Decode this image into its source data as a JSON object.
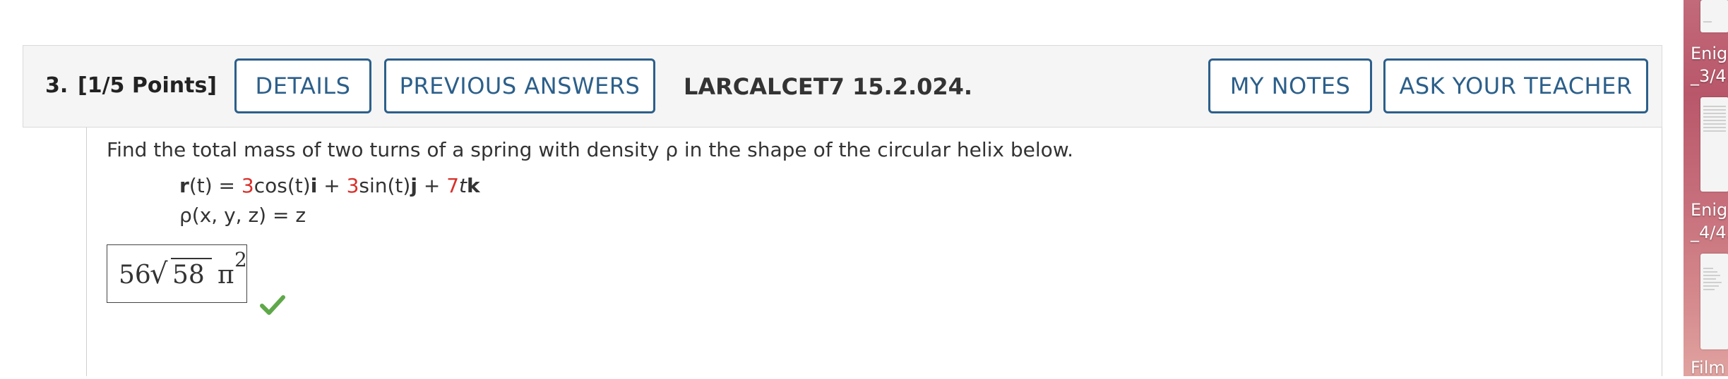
{
  "question": {
    "number": "3.",
    "points": "[1/5 Points]",
    "details_label": "DETAILS",
    "previous_answers_label": "PREVIOUS ANSWERS",
    "assignment_code": "LARCALCET7 15.2.024.",
    "my_notes_label": "MY NOTES",
    "ask_teacher_label": "ASK YOUR TEACHER",
    "prompt": "Find the total mass of two turns of a spring with density ρ in the shape of the circular helix below.",
    "eq1": {
      "r": "r",
      "t1": "(t) = ",
      "c1": "3",
      "part1": "cos(t)",
      "i": "i",
      "plus1": " + ",
      "c2": "3",
      "part2": "sin(t)",
      "j": "j",
      "plus2": " + ",
      "c3": "7",
      "t2": "t",
      "k": "k"
    },
    "eq2": "ρ(x, y, z) = z",
    "answer": {
      "coefficient": "56",
      "radical_sign": "√",
      "radicand": "58",
      "pi": "π",
      "exponent": "2"
    },
    "status": "correct"
  },
  "desktop": {
    "labels": [
      "Enig",
      "_3/4.",
      "Enig",
      "_4/4.",
      "Film"
    ],
    "background_color": "#c26a7a"
  },
  "colors": {
    "accent": "#2c5f8a",
    "coefficient_red": "#d9302a",
    "check_green": "#5fa84a"
  }
}
